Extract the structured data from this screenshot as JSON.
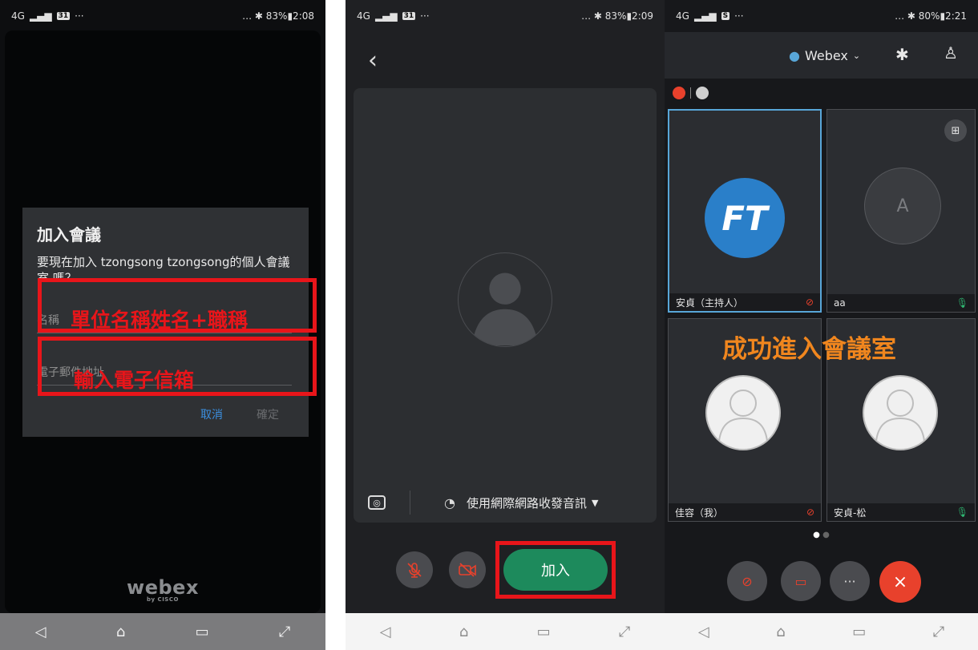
{
  "screen1": {
    "status": {
      "left": "4G",
      "right": "… ✱ 83%▮2:08",
      "calendar": "31"
    },
    "dialog": {
      "title": "加入會議",
      "message": "要現在加入 tzongsong tzongsong的個人會議室 嗎？",
      "name_placeholder": "名稱",
      "email_placeholder": "電子郵件地址",
      "cancel": "取消",
      "confirm": "確定"
    },
    "annotations": {
      "name_hint": "單位名稱姓名+職稱",
      "email_hint": "輸入電子信箱"
    },
    "logo": {
      "main": "webex",
      "sub": "by CISCO"
    }
  },
  "screen2": {
    "status": {
      "left": "4G",
      "right": "… ✱ 83%▮2:09",
      "calendar": "31"
    },
    "audio_option": "使用網際網路收發音訊",
    "join": "加入"
  },
  "screen3": {
    "status": {
      "left": "4G",
      "right": "… ✱ 80%▮2:21",
      "calendar": "S"
    },
    "app_title": "Webex",
    "tiles": [
      {
        "name": "安貞（主持人）"
      },
      {
        "name": "aa",
        "initial": "A"
      },
      {
        "name": "佳容（我）"
      },
      {
        "name": "安貞-松"
      }
    ],
    "success": "成功進入會議室",
    "logo_text": "FT"
  },
  "colors": {
    "annotation_red": "#e8151a",
    "success_orange": "#f0861e",
    "join_green": "#1d8a5c",
    "end_red": "#e8412c"
  }
}
